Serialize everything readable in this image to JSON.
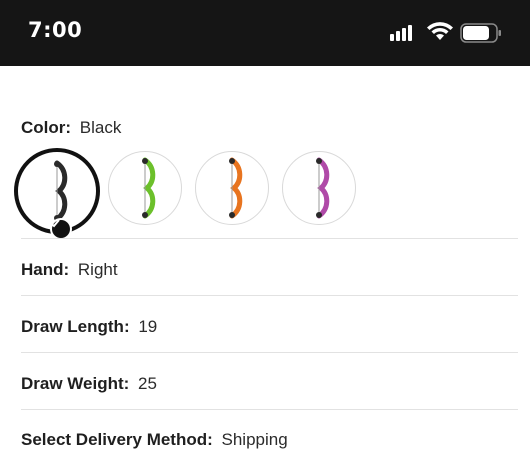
{
  "status_bar": {
    "time": "7:00",
    "icons": [
      "signal-icon",
      "wifi-icon",
      "battery-icon"
    ]
  },
  "color": {
    "label": "Color:",
    "value": "Black",
    "swatches": [
      {
        "name": "Black",
        "accent": "#2a2a2a",
        "selected": true
      },
      {
        "name": "Green",
        "accent": "#6cc02b",
        "selected": false
      },
      {
        "name": "Orange",
        "accent": "#e8741f",
        "selected": false
      },
      {
        "name": "Purple",
        "accent": "#b04aa8",
        "selected": false
      }
    ]
  },
  "options": [
    {
      "label": "Hand:",
      "value": "Right"
    },
    {
      "label": "Draw Length:",
      "value": "19"
    },
    {
      "label": "Draw Weight:",
      "value": "25"
    },
    {
      "label": "Select Delivery Method:",
      "value": "Shipping"
    }
  ],
  "colors": {
    "status_bar_bg": "#151515",
    "divider": "#e2e2e2",
    "selected_ring": "#111111"
  }
}
